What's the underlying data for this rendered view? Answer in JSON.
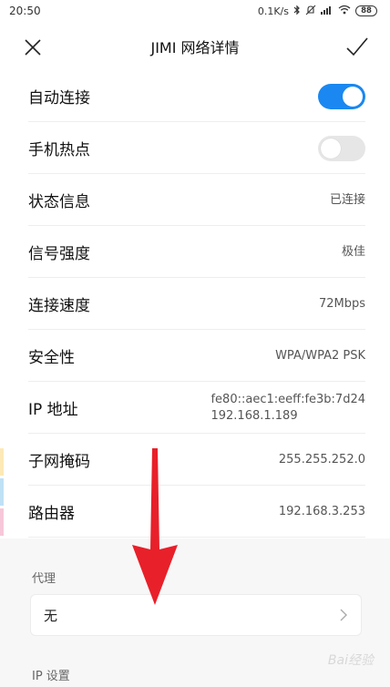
{
  "status_bar": {
    "time": "20:50",
    "speed": "0.1K/s",
    "battery": "88",
    "icons": [
      "bluetooth-icon",
      "mute-icon",
      "signal-icon",
      "wifi-icon",
      "battery-icon"
    ]
  },
  "header": {
    "title": "JIMI 网络详情"
  },
  "rows": {
    "auto_connect": {
      "label": "自动连接",
      "enabled": true
    },
    "hotspot": {
      "label": "手机热点",
      "enabled": false
    },
    "status": {
      "label": "状态信息",
      "value": "已连接"
    },
    "signal": {
      "label": "信号强度",
      "value": "极佳"
    },
    "speed": {
      "label": "连接速度",
      "value": "72Mbps"
    },
    "security": {
      "label": "安全性",
      "value": "WPA/WPA2 PSK"
    },
    "ip": {
      "label": "IP 地址",
      "value_v6": "fe80::aec1:eeff:fe3b:7d24",
      "value_v4": "192.168.1.189"
    },
    "subnet": {
      "label": "子网掩码",
      "value": "255.255.252.0"
    },
    "router": {
      "label": "路由器",
      "value": "192.168.3.253"
    }
  },
  "proxy": {
    "section_label": "代理",
    "value": "无"
  },
  "ip_settings": {
    "section_label": "IP 设置"
  },
  "colors": {
    "accent": "#1a88f0",
    "arrow": "#e8202a"
  }
}
